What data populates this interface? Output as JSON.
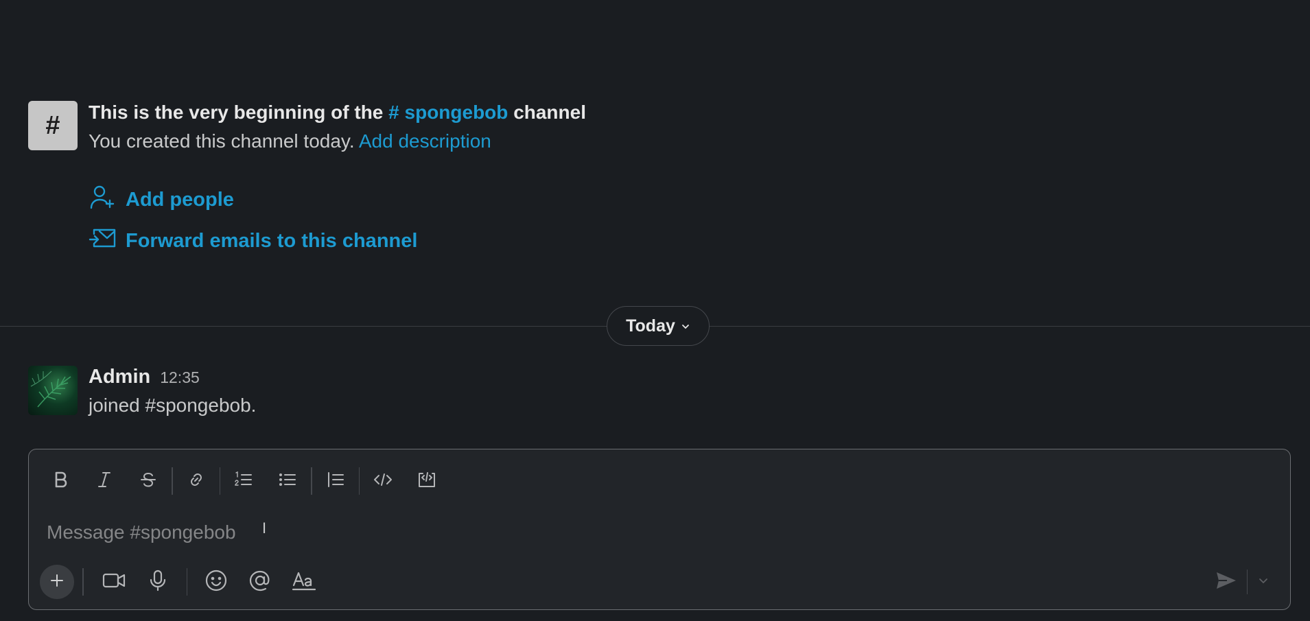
{
  "intro": {
    "badge_symbol": "#",
    "title_prefix": "This is the very beginning of the",
    "channel_name": "# spongebob",
    "title_suffix": "channel",
    "subtitle": "You created this channel today.",
    "add_description": "Add description"
  },
  "actions": {
    "add_people": "Add people",
    "forward_emails": "Forward emails to this channel"
  },
  "date_divider": {
    "label": "Today"
  },
  "message": {
    "author": "Admin",
    "time": "12:35",
    "text": "joined #spongebob."
  },
  "composer": {
    "placeholder": "Message #spongebob",
    "cursor": "I"
  },
  "colors": {
    "background": "#1a1d21",
    "link": "#1d9bd1",
    "composer_bg": "#222529"
  },
  "icons": {
    "toolbar": [
      "bold-icon",
      "italic-icon",
      "strikethrough-icon",
      "link-icon",
      "ordered-list-icon",
      "bullet-list-icon",
      "blockquote-icon",
      "code-icon",
      "code-block-icon"
    ],
    "bottom": [
      "plus-icon",
      "video-icon",
      "microphone-icon",
      "emoji-icon",
      "mention-icon",
      "formatting-icon",
      "send-icon",
      "chevron-down-icon"
    ]
  }
}
